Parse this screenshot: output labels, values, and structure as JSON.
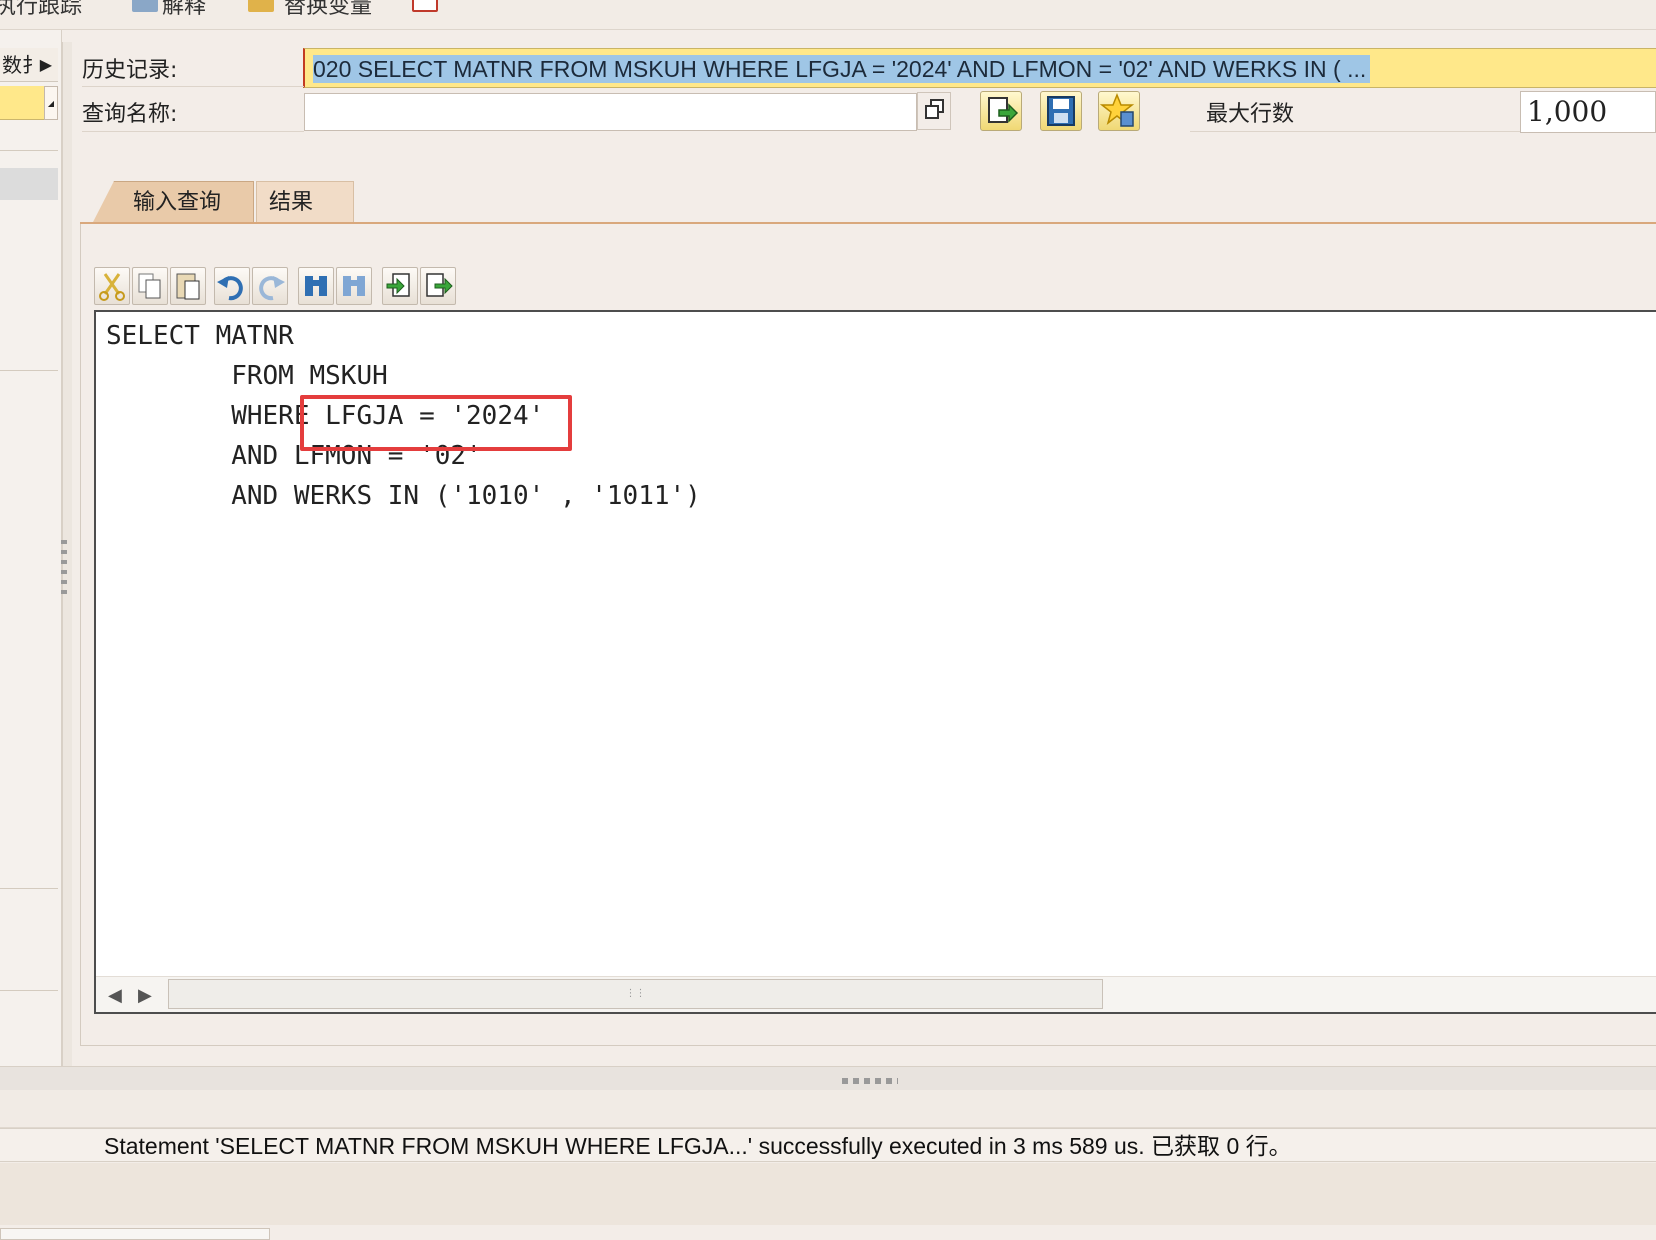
{
  "toolbar": {
    "execute_trace_label": "执行跟踪",
    "explain_label": "解释",
    "replace_variables_label": "替换变量"
  },
  "left_panel": {
    "tab_label": "数扌"
  },
  "header": {
    "history_label": "历史记录:",
    "history_value": "020 SELECT MATNR FROM MSKUH WHERE LFGJA = '2024' AND LFMON = '02' AND WERKS IN ( ...",
    "query_name_label": "查询名称:",
    "query_name_value": "",
    "max_rows_label": "最大行数",
    "max_rows_value": "1,000"
  },
  "tabs": [
    {
      "label": "输入查询",
      "active": true
    },
    {
      "label": "结果",
      "active": false
    }
  ],
  "editor_toolbar": {
    "icons": [
      "cut-icon",
      "copy-icon",
      "paste-icon",
      "undo-icon",
      "redo-icon",
      "find-icon",
      "find-replace-icon",
      "import-icon",
      "export-icon"
    ]
  },
  "editor": {
    "code": "SELECT MATNR\n        FROM MSKUH\n        WHERE LFGJA = '2024'\n        AND LFMON = '02'\n        AND WERKS IN ('1010' , '1011')"
  },
  "status": {
    "message": "Statement 'SELECT MATNR FROM MSKUH WHERE LFGJA...' successfully executed in 3 ms 589 us. 已获取 0 行。"
  },
  "colors": {
    "history_field_bg": "#ffe88a",
    "history_selection": "#9fc6e6",
    "active_tab": "#e9caa9",
    "highlight_box": "#e43d3d"
  }
}
